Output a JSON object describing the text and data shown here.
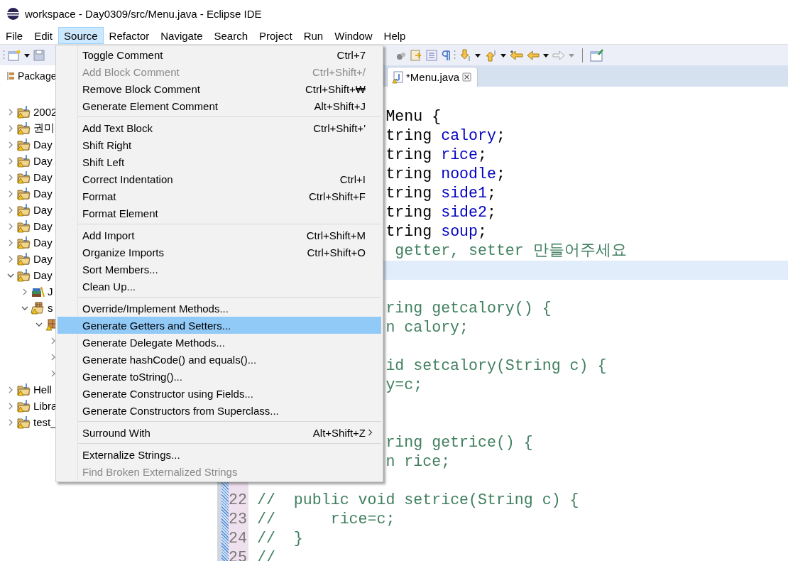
{
  "window": {
    "title": "workspace - Day0309/src/Menu.java - Eclipse IDE"
  },
  "menubar": [
    {
      "label": "File",
      "selected": false
    },
    {
      "label": "Edit",
      "selected": false
    },
    {
      "label": "Source",
      "selected": true
    },
    {
      "label": "Refactor",
      "selected": false
    },
    {
      "label": "Navigate",
      "selected": false
    },
    {
      "label": "Search",
      "selected": false
    },
    {
      "label": "Project",
      "selected": false
    },
    {
      "label": "Run",
      "selected": false
    },
    {
      "label": "Window",
      "selected": false
    },
    {
      "label": "Help",
      "selected": false
    }
  ],
  "explorer": {
    "tab": "Package",
    "tree": [
      {
        "label": "2002",
        "kind": "project",
        "expanded": false
      },
      {
        "label": "권미",
        "kind": "project",
        "expanded": false
      },
      {
        "label": "Day",
        "kind": "project",
        "expanded": false
      },
      {
        "label": "Day",
        "kind": "project",
        "expanded": false
      },
      {
        "label": "Day",
        "kind": "project",
        "expanded": false
      },
      {
        "label": "Day",
        "kind": "project",
        "expanded": false
      },
      {
        "label": "Day",
        "kind": "project",
        "expanded": false
      },
      {
        "label": "Day",
        "kind": "project",
        "expanded": false
      },
      {
        "label": "Day",
        "kind": "project",
        "expanded": false
      },
      {
        "label": "Day",
        "kind": "project",
        "expanded": false
      },
      {
        "label": "Day",
        "kind": "project",
        "expanded": true,
        "children": [
          {
            "label": "J",
            "kind": "library",
            "expanded": false
          },
          {
            "label": "s",
            "kind": "source",
            "expanded": true,
            "children": [
              {
                "kind": "package",
                "expanded": true,
                "children": [
                  {
                    "expanded": false
                  },
                  {
                    "expanded": false
                  },
                  {
                    "expanded": false
                  }
                ]
              }
            ]
          }
        ]
      },
      {
        "label": "Hell",
        "kind": "project",
        "expanded": false
      },
      {
        "label": "Libra",
        "kind": "project",
        "expanded": false
      },
      {
        "label": "test_",
        "kind": "project",
        "expanded": false
      }
    ]
  },
  "editor": {
    "tab": "*Menu.java",
    "lines": [
      {
        "kind": "clipped",
        "current": false
      },
      {
        "kind": "clipped",
        "current": false,
        "segments": [
          {
            "text": "Menu {",
            "kind": "plain"
          }
        ]
      },
      {
        "kind": "clipped",
        "current": false,
        "segments": [
          {
            "text": "tring ",
            "kind": "plain"
          },
          {
            "text": "calory",
            "kind": "field"
          },
          {
            "text": ";",
            "kind": "plain"
          }
        ]
      },
      {
        "kind": "clipped",
        "current": false,
        "segments": [
          {
            "text": "tring ",
            "kind": "plain"
          },
          {
            "text": "rice",
            "kind": "field"
          },
          {
            "text": ";",
            "kind": "plain"
          }
        ]
      },
      {
        "kind": "clipped",
        "current": false,
        "segments": [
          {
            "text": "tring ",
            "kind": "plain"
          },
          {
            "text": "noodle",
            "kind": "field"
          },
          {
            "text": ";",
            "kind": "plain"
          }
        ]
      },
      {
        "kind": "clipped",
        "current": false,
        "segments": [
          {
            "text": "tring ",
            "kind": "plain"
          },
          {
            "text": "side1",
            "kind": "field"
          },
          {
            "text": ";",
            "kind": "plain"
          }
        ]
      },
      {
        "kind": "clipped",
        "current": false,
        "segments": [
          {
            "text": "tring ",
            "kind": "plain"
          },
          {
            "text": "side2",
            "kind": "field"
          },
          {
            "text": ";",
            "kind": "plain"
          }
        ]
      },
      {
        "kind": "clipped",
        "current": false,
        "segments": [
          {
            "text": "tring ",
            "kind": "plain"
          },
          {
            "text": "soup",
            "kind": "field"
          },
          {
            "text": ";",
            "kind": "plain"
          }
        ]
      },
      {
        "kind": "clipped",
        "current": false,
        "segments": [
          {
            "text": " getter, setter 만들어주세요",
            "kind": "comment"
          }
        ]
      },
      {
        "kind": "clipped",
        "current": true
      },
      {
        "kind": "clipped",
        "current": false
      },
      {
        "kind": "clipped",
        "current": false,
        "segments": [
          {
            "text": "ring getcalory() {",
            "kind": "comment"
          }
        ]
      },
      {
        "kind": "clipped",
        "current": false,
        "segments": [
          {
            "text": "n calory;",
            "kind": "comment"
          }
        ]
      },
      {
        "kind": "clipped",
        "current": false
      },
      {
        "kind": "clipped",
        "current": false,
        "segments": [
          {
            "text": "id setcalory(String c) {",
            "kind": "comment"
          }
        ]
      },
      {
        "kind": "clipped",
        "current": false,
        "segments": [
          {
            "text": "y=c;",
            "kind": "comment"
          }
        ]
      },
      {
        "kind": "clipped",
        "current": false
      },
      {
        "kind": "clipped",
        "current": false
      },
      {
        "kind": "clipped",
        "current": false,
        "segments": [
          {
            "text": "ring getrice() {",
            "kind": "comment"
          }
        ]
      },
      {
        "kind": "clipped",
        "current": false,
        "segments": [
          {
            "text": "n rice;",
            "kind": "comment"
          }
        ]
      },
      {
        "kind": "clipped",
        "current": false
      },
      {
        "kind": "full",
        "number": "22",
        "current": false,
        "segments": [
          {
            "text": "//  public void setrice(String c) {",
            "kind": "comment"
          }
        ]
      },
      {
        "kind": "full",
        "number": "23",
        "current": false,
        "segments": [
          {
            "text": "//      rice=c;",
            "kind": "comment"
          }
        ]
      },
      {
        "kind": "full",
        "number": "24",
        "current": false,
        "segments": [
          {
            "text": "//  }",
            "kind": "comment"
          }
        ]
      },
      {
        "kind": "full",
        "number": "25",
        "current": false,
        "segments": [
          {
            "text": "//",
            "kind": "comment"
          }
        ]
      }
    ]
  },
  "popup_menu": {
    "items": [
      {
        "kind": "item",
        "label": "Toggle Comment",
        "shortcut": "Ctrl+7",
        "disabled": false,
        "selected": false,
        "submenu": false
      },
      {
        "kind": "item",
        "label": "Add Block Comment",
        "shortcut": "Ctrl+Shift+/",
        "disabled": true,
        "selected": false,
        "submenu": false
      },
      {
        "kind": "item",
        "label": "Remove Block Comment",
        "shortcut": "Ctrl+Shift+₩",
        "disabled": false,
        "selected": false,
        "submenu": false
      },
      {
        "kind": "item",
        "label": "Generate Element Comment",
        "shortcut": "Alt+Shift+J",
        "disabled": false,
        "selected": false,
        "submenu": false
      },
      {
        "kind": "separator"
      },
      {
        "kind": "item",
        "label": "Add Text Block",
        "shortcut": "Ctrl+Shift+'",
        "disabled": false,
        "selected": false,
        "submenu": false
      },
      {
        "kind": "item",
        "label": "Shift Right",
        "disabled": false,
        "selected": false,
        "submenu": false
      },
      {
        "kind": "item",
        "label": "Shift Left",
        "disabled": false,
        "selected": false,
        "submenu": false
      },
      {
        "kind": "item",
        "label": "Correct Indentation",
        "shortcut": "Ctrl+I",
        "disabled": false,
        "selected": false,
        "submenu": false
      },
      {
        "kind": "item",
        "label": "Format",
        "shortcut": "Ctrl+Shift+F",
        "disabled": false,
        "selected": false,
        "submenu": false
      },
      {
        "kind": "item",
        "label": "Format Element",
        "disabled": false,
        "selected": false,
        "submenu": false
      },
      {
        "kind": "separator"
      },
      {
        "kind": "item",
        "label": "Add Import",
        "shortcut": "Ctrl+Shift+M",
        "disabled": false,
        "selected": false,
        "submenu": false
      },
      {
        "kind": "item",
        "label": "Organize Imports",
        "shortcut": "Ctrl+Shift+O",
        "disabled": false,
        "selected": false,
        "submenu": false
      },
      {
        "kind": "item",
        "label": "Sort Members...",
        "disabled": false,
        "selected": false,
        "submenu": false
      },
      {
        "kind": "item",
        "label": "Clean Up...",
        "disabled": false,
        "selected": false,
        "submenu": false
      },
      {
        "kind": "separator"
      },
      {
        "kind": "item",
        "label": "Override/Implement Methods...",
        "disabled": false,
        "selected": false,
        "submenu": false
      },
      {
        "kind": "item",
        "label": "Generate Getters and Setters...",
        "disabled": false,
        "selected": true,
        "submenu": false
      },
      {
        "kind": "item",
        "label": "Generate Delegate Methods...",
        "disabled": false,
        "selected": false,
        "submenu": false
      },
      {
        "kind": "item",
        "label": "Generate hashCode() and equals()...",
        "disabled": false,
        "selected": false,
        "submenu": false
      },
      {
        "kind": "item",
        "label": "Generate toString()...",
        "disabled": false,
        "selected": false,
        "submenu": false
      },
      {
        "kind": "item",
        "label": "Generate Constructor using Fields...",
        "disabled": false,
        "selected": false,
        "submenu": false
      },
      {
        "kind": "item",
        "label": "Generate Constructors from Superclass...",
        "disabled": false,
        "selected": false,
        "submenu": false
      },
      {
        "kind": "separator"
      },
      {
        "kind": "item",
        "label": "Surround With",
        "shortcut": "Alt+Shift+Z",
        "disabled": false,
        "selected": false,
        "submenu": true
      },
      {
        "kind": "separator"
      },
      {
        "kind": "item",
        "label": "Externalize Strings...",
        "disabled": false,
        "selected": false,
        "submenu": false
      },
      {
        "kind": "item",
        "label": "Find Broken Externalized Strings",
        "disabled": true,
        "selected": false,
        "submenu": false
      }
    ]
  }
}
